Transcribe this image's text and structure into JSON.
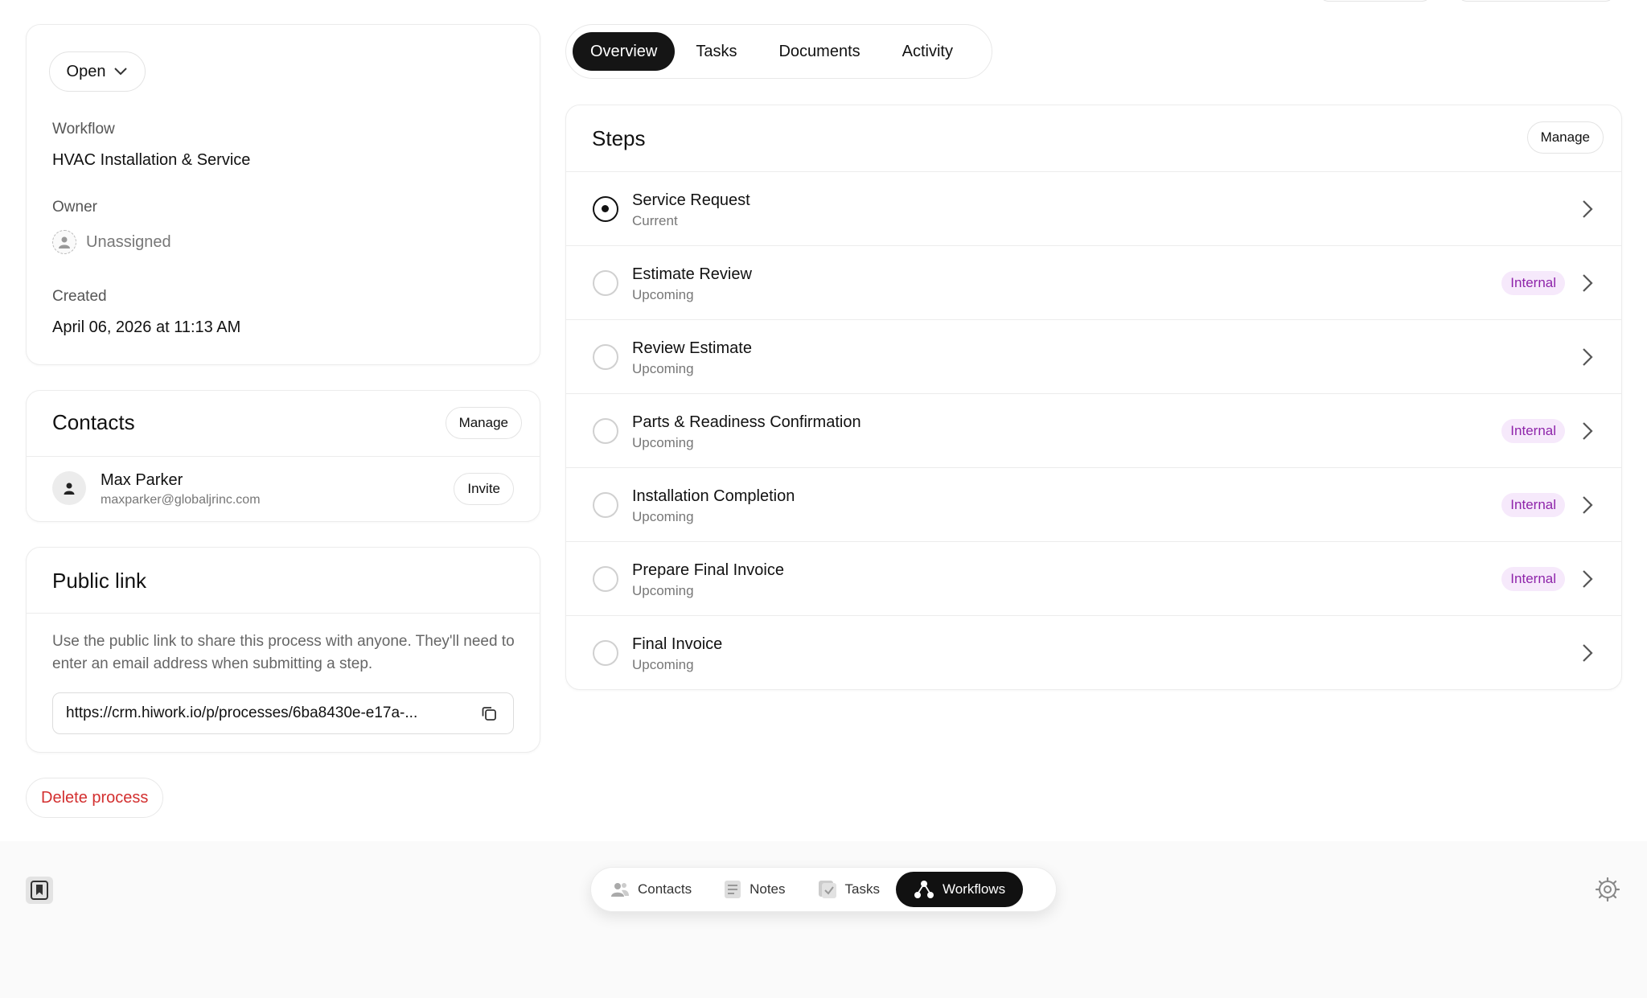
{
  "details": {
    "status": "Open",
    "workflow_label": "Workflow",
    "workflow_value": "HVAC Installation & Service",
    "owner_label": "Owner",
    "owner_value": "Unassigned",
    "created_label": "Created",
    "created_value": "April 06, 2026 at 11:13 AM"
  },
  "contacts": {
    "title": "Contacts",
    "manage_label": "Manage",
    "items": [
      {
        "name": "Max Parker",
        "email": "maxparker@globaljrinc.com",
        "action": "Invite"
      }
    ]
  },
  "public_link": {
    "title": "Public link",
    "description": "Use the public link to share this process with anyone. They'll need to enter an email address when submitting a step.",
    "url": "https://crm.hiwork.io/p/processes/6ba8430e-e17a-..."
  },
  "delete_label": "Delete process",
  "tabs": [
    {
      "label": "Overview",
      "active": true
    },
    {
      "label": "Tasks",
      "active": false
    },
    {
      "label": "Documents",
      "active": false
    },
    {
      "label": "Activity",
      "active": false
    }
  ],
  "steps": {
    "title": "Steps",
    "manage_label": "Manage",
    "items": [
      {
        "name": "Service Request",
        "status": "Current",
        "current": true,
        "badge": ""
      },
      {
        "name": "Estimate Review",
        "status": "Upcoming",
        "current": false,
        "badge": "Internal"
      },
      {
        "name": "Review Estimate",
        "status": "Upcoming",
        "current": false,
        "badge": ""
      },
      {
        "name": "Parts & Readiness Confirmation",
        "status": "Upcoming",
        "current": false,
        "badge": "Internal"
      },
      {
        "name": "Installation Completion",
        "status": "Upcoming",
        "current": false,
        "badge": "Internal"
      },
      {
        "name": "Prepare Final Invoice",
        "status": "Upcoming",
        "current": false,
        "badge": "Internal"
      },
      {
        "name": "Final Invoice",
        "status": "Upcoming",
        "current": false,
        "badge": ""
      }
    ]
  },
  "nav": {
    "items": [
      {
        "label": "Contacts",
        "icon": "users-icon",
        "active": false
      },
      {
        "label": "Notes",
        "icon": "notes-icon",
        "active": false
      },
      {
        "label": "Tasks",
        "icon": "tasks-icon",
        "active": false
      },
      {
        "label": "Workflows",
        "icon": "workflows-icon",
        "active": true
      }
    ]
  },
  "colors": {
    "accent_dark": "#151515",
    "danger": "#d32f2f",
    "internal_badge_bg": "#f6e9fb",
    "internal_badge_text": "#8e24aa"
  }
}
